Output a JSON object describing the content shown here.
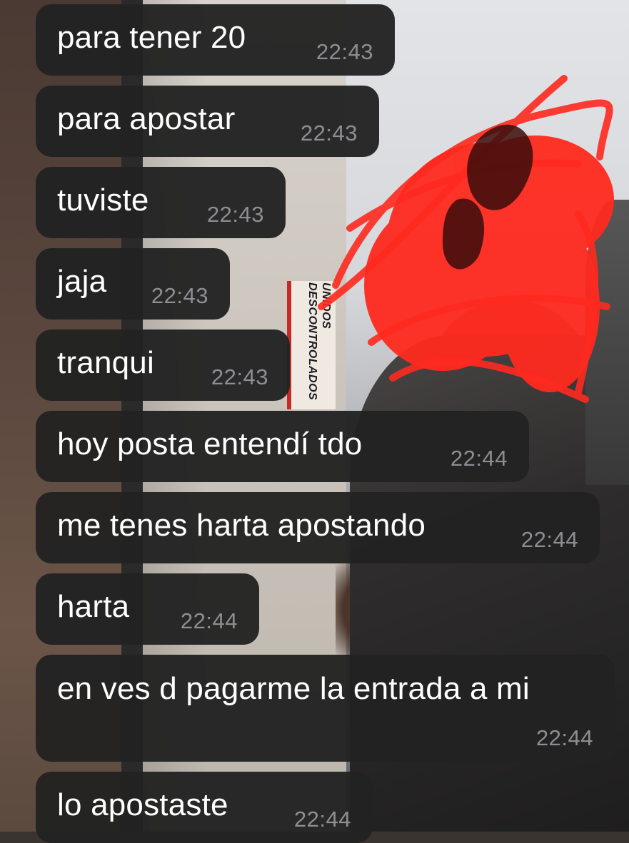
{
  "background": {
    "sticker_line1": "UNIDOS",
    "sticker_line2": "DESCONTROLADOS"
  },
  "messages": [
    {
      "text": "para tener 20",
      "time": "22:43"
    },
    {
      "text": "para apostar",
      "time": "22:43"
    },
    {
      "text": "tuviste",
      "time": "22:43"
    },
    {
      "text": "jaja",
      "time": "22:43"
    },
    {
      "text": "tranqui",
      "time": "22:43"
    },
    {
      "text": "hoy posta entendí tdo",
      "time": "22:44"
    },
    {
      "text": "me tenes harta apostando",
      "time": "22:44"
    },
    {
      "text": "harta",
      "time": "22:44"
    },
    {
      "text": "en ves d pagarme la entrada a mi",
      "time": "22:44"
    },
    {
      "text": "lo apostaste",
      "time": "22:44"
    }
  ],
  "colors": {
    "bubble": "#222222",
    "message_text": "#ffffff",
    "timestamp": "#8e8e93",
    "scribble": "#ff2a1f"
  }
}
